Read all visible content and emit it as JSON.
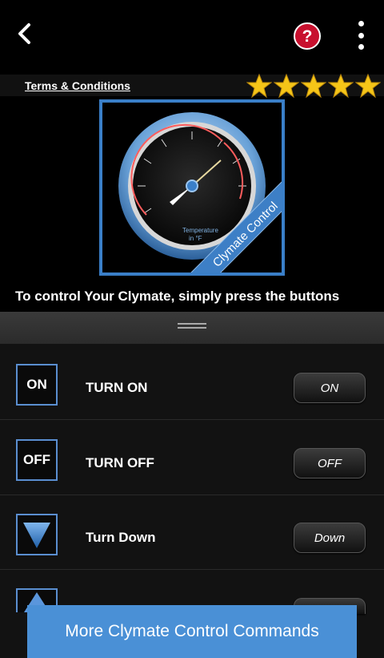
{
  "topbar": {
    "back_icon": "chevron-left-icon",
    "help_icon": "help-icon",
    "menu_icon": "kebab-menu-icon",
    "help_symbol": "?"
  },
  "header": {
    "terms_link": "Terms & Conditions",
    "rating_stars": 5
  },
  "gauge": {
    "banner_text": "Clymate Control",
    "dial_label_line1": "Temperature",
    "dial_label_line2": "in °F"
  },
  "caption": "To control Your Clymate, simply press the buttons",
  "commands": [
    {
      "icon_text": "ON",
      "label": "TURN ON",
      "button": "ON"
    },
    {
      "icon_text": "OFF",
      "label": "TURN OFF",
      "button": "OFF"
    },
    {
      "icon_text": "",
      "label": "Turn Down",
      "button": "Down"
    }
  ],
  "more_button": "More Clymate Control Commands",
  "colors": {
    "accent_blue": "#4a90d6",
    "frame_blue": "#3a7fc8",
    "help_red": "#c8102e",
    "star_gold": "#f5c518"
  }
}
